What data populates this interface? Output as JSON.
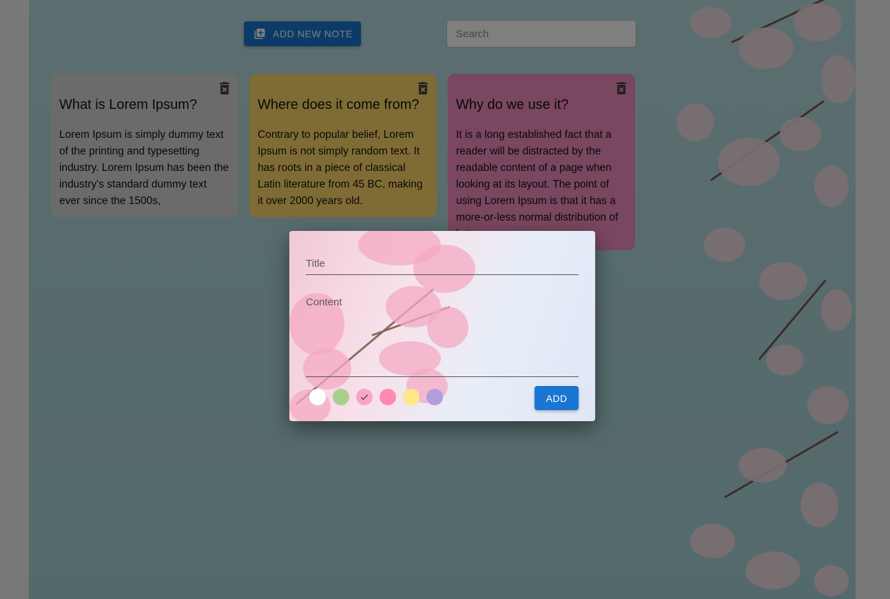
{
  "toolbar": {
    "add_button_label": "ADD NEW NOTE",
    "search_placeholder": "Search"
  },
  "notes": [
    {
      "title": "What is Lorem Ipsum?",
      "content": "Lorem Ipsum is simply dummy text of the printing and typesetting industry. Lorem Ipsum has been the industry's standard dummy text ever since the 1500s,",
      "color": "#d6d6d6"
    },
    {
      "title": "Where does it come from?",
      "content": "Contrary to popular belief, Lorem Ipsum is not simply random text. It has roots in a piece of classical Latin literature from 45 BC, making it over 2000 years old.",
      "color": "#ffd86b"
    },
    {
      "title": "Why do we use it?",
      "content": "It is a long established fact that a reader will be distracted by the readable content of a page when looking at its layout. The point of using Lorem Ipsum is that it has a more-or-less normal distribution of letters",
      "color": "#f28fbf"
    }
  ],
  "dialog": {
    "title_label": "Title",
    "content_label": "Content",
    "submit_label": "ADD",
    "colors": [
      "#ffffff",
      "#a8d08d",
      "#f8a5c8",
      "#ff8ab0",
      "#ffe88a",
      "#b39ddb"
    ],
    "selected_color_index": 2
  }
}
